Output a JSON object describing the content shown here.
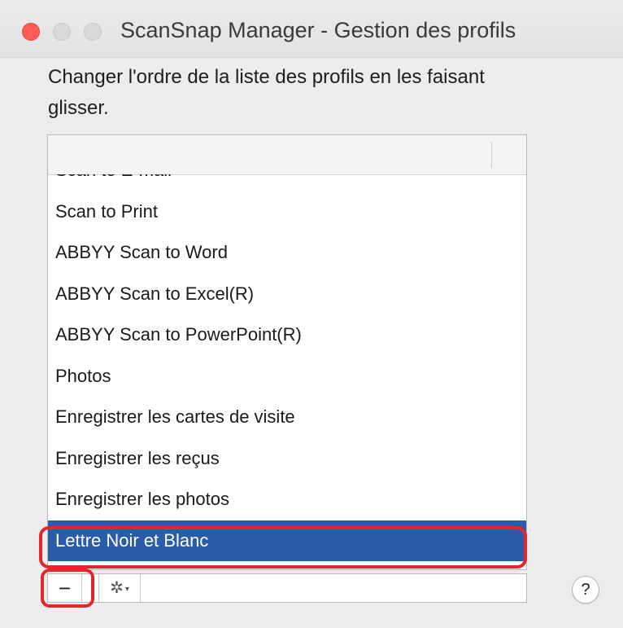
{
  "window": {
    "title": "ScanSnap Manager - Gestion des profils"
  },
  "instruction": "Changer l'ordre de la liste des profils en les faisant glisser.",
  "profiles": [
    {
      "label": "Scan to E-mail",
      "selected": false
    },
    {
      "label": "Scan to Print",
      "selected": false
    },
    {
      "label": "ABBYY Scan to Word",
      "selected": false
    },
    {
      "label": "ABBYY Scan to Excel(R)",
      "selected": false
    },
    {
      "label": "ABBYY Scan to PowerPoint(R)",
      "selected": false
    },
    {
      "label": "Photos",
      "selected": false
    },
    {
      "label": "Enregistrer les cartes de visite",
      "selected": false
    },
    {
      "label": "Enregistrer les reçus",
      "selected": false
    },
    {
      "label": "Enregistrer les photos",
      "selected": false
    },
    {
      "label": "Lettre Noir et Blanc",
      "selected": true
    }
  ],
  "toolbar": {
    "remove_label": "−",
    "remove_icon": "minus-icon",
    "action_icon": "gear-icon",
    "action_glyph": "✲",
    "caret_glyph": "▾"
  },
  "help": {
    "label": "?"
  },
  "colors": {
    "selection": "#2b5cac",
    "annotation": "#e3262c",
    "close": "#fc5b57"
  }
}
